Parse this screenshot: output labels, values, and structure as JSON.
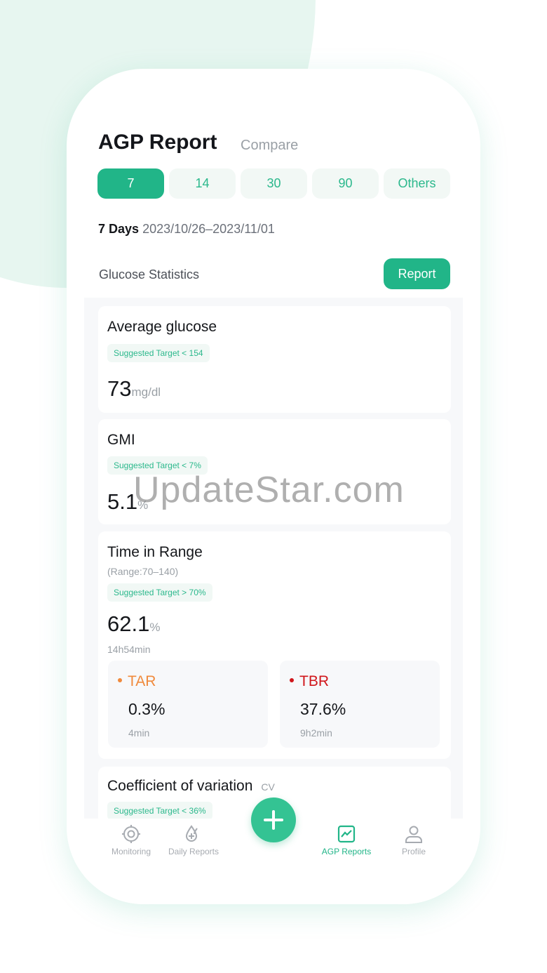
{
  "header": {
    "title": "AGP Report",
    "compare_label": "Compare"
  },
  "period_tabs": [
    {
      "label": "7",
      "active": true
    },
    {
      "label": "14",
      "active": false
    },
    {
      "label": "30",
      "active": false
    },
    {
      "label": "90",
      "active": false
    },
    {
      "label": "Others",
      "active": false
    }
  ],
  "date_range": {
    "days": "7 Days",
    "range": "2023/10/26–2023/11/01"
  },
  "section": {
    "title": "Glucose Statistics",
    "report_button": "Report"
  },
  "average_glucose": {
    "title": "Average glucose",
    "target": "Suggested Target < 154",
    "value": "73",
    "unit": "mg/dl"
  },
  "gmi": {
    "title": "GMI",
    "target": "Suggested Target < 7%",
    "value": "5.1",
    "unit": "%"
  },
  "time_in_range": {
    "title": "Time in Range",
    "range_note": "(Range:70–140)",
    "target": "Suggested Target > 70%",
    "value": "62.1",
    "unit": "%",
    "duration": "14h54min",
    "tar": {
      "label": "TAR",
      "value": "0.3%",
      "duration": "4min",
      "color": "#f08a3c"
    },
    "tbr": {
      "label": "TBR",
      "value": "37.6%",
      "duration": "9h2min",
      "color": "#d0161b"
    }
  },
  "coefficient_of_variation": {
    "title": "Coefficient of variation",
    "tag": "CV",
    "target": "Suggested Target < 36%"
  },
  "bottom_nav": [
    {
      "label": "Monitoring",
      "icon": "target-icon",
      "active": false
    },
    {
      "label": "Daily Reports",
      "icon": "drop-plus-icon",
      "active": false
    },
    {
      "label": "AGP Reports",
      "icon": "chart-icon",
      "active": true
    },
    {
      "label": "Profile",
      "icon": "person-icon",
      "active": false
    }
  ],
  "watermark": "UpdateStar.com",
  "colors": {
    "accent": "#21b588",
    "tar": "#f08a3c",
    "tbr": "#d0161b"
  }
}
